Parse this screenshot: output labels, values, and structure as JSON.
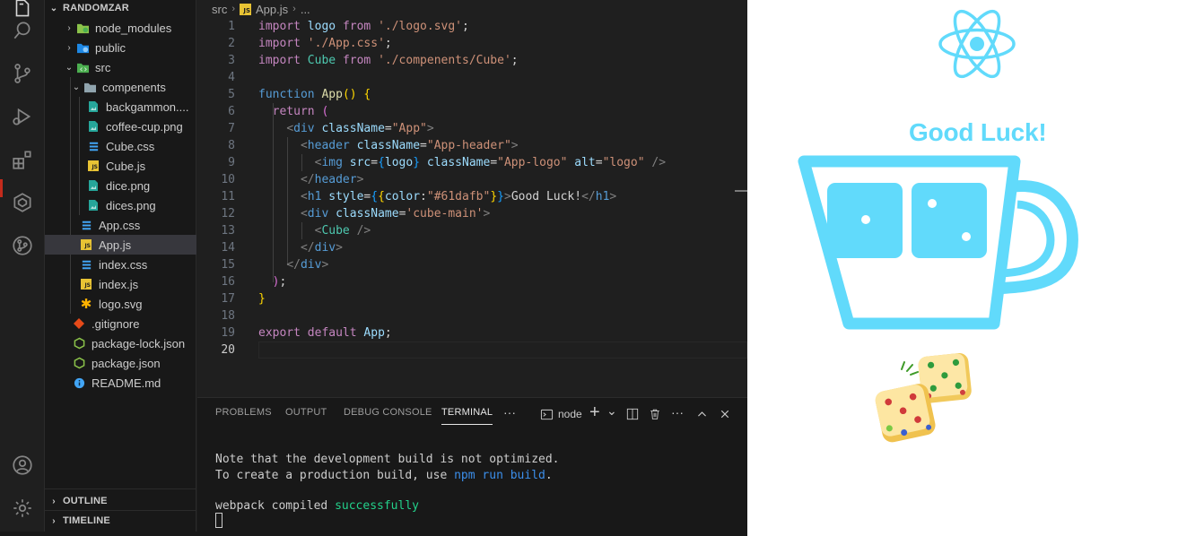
{
  "explorer": {
    "root_label": "RANDOMZAR",
    "outline_label": "OUTLINE",
    "timeline_label": "TIMELINE",
    "items": [
      {
        "label": "node_modules",
        "kind": "folder-node"
      },
      {
        "label": "public",
        "kind": "folder-public"
      },
      {
        "label": "src",
        "kind": "folder-src"
      },
      {
        "label": "compenents",
        "kind": "folder"
      },
      {
        "label": "backgammon....",
        "kind": "image"
      },
      {
        "label": "coffee-cup.png",
        "kind": "image"
      },
      {
        "label": "Cube.css",
        "kind": "css"
      },
      {
        "label": "Cube.js",
        "kind": "js"
      },
      {
        "label": "dice.png",
        "kind": "image"
      },
      {
        "label": "dices.png",
        "kind": "image"
      },
      {
        "label": "App.css",
        "kind": "css"
      },
      {
        "label": "App.js",
        "kind": "js",
        "selected": true
      },
      {
        "label": "index.css",
        "kind": "css"
      },
      {
        "label": "index.js",
        "kind": "js"
      },
      {
        "label": "logo.svg",
        "kind": "svg"
      },
      {
        "label": ".gitignore",
        "kind": "git"
      },
      {
        "label": "package-lock.json",
        "kind": "npm"
      },
      {
        "label": "package.json",
        "kind": "npm"
      },
      {
        "label": "README.md",
        "kind": "info"
      }
    ]
  },
  "breadcrumb": {
    "folder": "src",
    "file": "App.js",
    "symbol": "...",
    "js_badge": "JS"
  },
  "editor": {
    "current_line": "20",
    "lines": [
      {
        "num": "1",
        "text": "import logo from './logo.svg';"
      },
      {
        "num": "2",
        "text": "import './App.css';"
      },
      {
        "num": "3",
        "text": "import Cube from './compenents/Cube';"
      },
      {
        "num": "4",
        "text": ""
      },
      {
        "num": "5",
        "text": "function App() {"
      },
      {
        "num": "6",
        "text": "  return ("
      },
      {
        "num": "7",
        "text": "    <div className=\"App\">"
      },
      {
        "num": "8",
        "text": "      <header className=\"App-header\">"
      },
      {
        "num": "9",
        "text": "        <img src={logo} className=\"App-logo\" alt=\"logo\" />"
      },
      {
        "num": "10",
        "text": "      </header>"
      },
      {
        "num": "11",
        "text": "      <h1 style={{color:\"#61dafb\"}}>Good Luck!</h1>"
      },
      {
        "num": "12",
        "text": "      <div className='cube-main'>"
      },
      {
        "num": "13",
        "text": "        <Cube />"
      },
      {
        "num": "14",
        "text": "      </div>"
      },
      {
        "num": "15",
        "text": "    </div>"
      },
      {
        "num": "16",
        "text": "  );"
      },
      {
        "num": "17",
        "text": "}"
      },
      {
        "num": "18",
        "text": ""
      },
      {
        "num": "19",
        "text": "export default App;"
      },
      {
        "num": "20",
        "text": ""
      }
    ]
  },
  "panel": {
    "tabs": [
      "PROBLEMS",
      "OUTPUT",
      "DEBUG CONSOLE",
      "TERMINAL"
    ],
    "active_tab": "TERMINAL",
    "more": "···",
    "terminal_name": "node",
    "add": "+",
    "dropdown": "⌄",
    "terminal_lines": [
      "Note that the development build is not optimized.",
      "To create a production build, use ",
      "npm run build",
      ".",
      "webpack compiled ",
      "successfully"
    ]
  },
  "preview": {
    "heading": "Good Luck!",
    "heading_color": "#61dafb",
    "cup_color": "#61dafb",
    "react_logo_color": "#61dafb"
  },
  "colors": {
    "accent_terminal_success": "#23d18b",
    "link": "#3b8eea",
    "selected_row": "#37373d"
  }
}
